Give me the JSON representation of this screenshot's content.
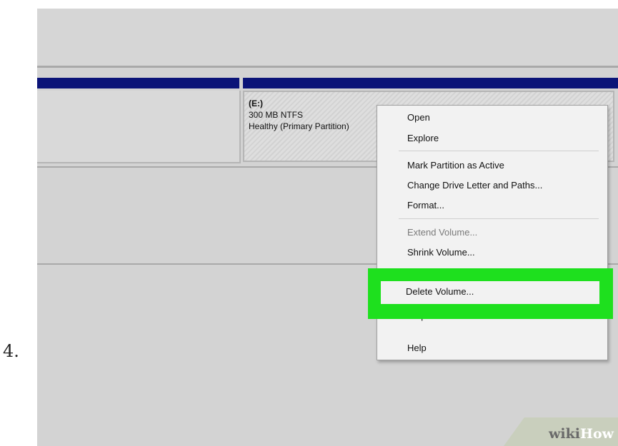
{
  "step": {
    "number": "4."
  },
  "disk": {
    "partition": {
      "drive_letter": "(E:)",
      "size_fs": "300 MB NTFS",
      "status": "Healthy (Primary Partition)"
    }
  },
  "context_menu": {
    "items": [
      {
        "label": "Open",
        "enabled": true
      },
      {
        "label": "Explore",
        "enabled": true
      },
      {
        "label": "Mark Partition as Active",
        "enabled": true
      },
      {
        "label": "Change Drive Letter and Paths...",
        "enabled": true
      },
      {
        "label": "Format...",
        "enabled": true
      },
      {
        "label": "Extend Volume...",
        "enabled": false
      },
      {
        "label": "Shrink Volume...",
        "enabled": true
      },
      {
        "label": "Delete Volume...",
        "enabled": true,
        "highlighted": true
      },
      {
        "label": "Properties",
        "enabled": true
      },
      {
        "label": "Help",
        "enabled": true
      }
    ]
  },
  "highlight": {
    "color": "#1ee01e"
  },
  "watermark": {
    "wiki": "wiki",
    "how": "How"
  }
}
